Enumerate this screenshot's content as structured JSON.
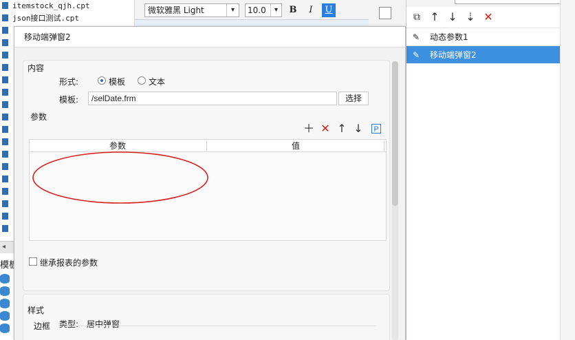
{
  "file_tree": {
    "items": [
      {
        "label": "itemstock_qjh.cpt"
      },
      {
        "label": "json接口测试.cpt"
      }
    ],
    "template_panel_label": "模板"
  },
  "toolbar": {
    "font_name": "微软雅黑 Light",
    "font_size": "10.0",
    "bold": "B",
    "italic": "I",
    "underline": "U"
  },
  "right_panel": {
    "items": [
      {
        "label": "动态参数1",
        "selected": false
      },
      {
        "label": "移动端弹窗2",
        "selected": true
      }
    ],
    "selected_color": "#3d8fe0"
  },
  "dialog": {
    "title": "移动端弹窗2",
    "content": {
      "section_title": "内容",
      "form_label": "形式:",
      "options": [
        "模板",
        "文本"
      ],
      "selected_option": "模板",
      "template_label": "模板:",
      "template_value": "/selDate.frm",
      "choose_button": "选择"
    },
    "params": {
      "section_title": "参数",
      "columns": [
        "参数",
        "值"
      ],
      "rows": [],
      "inherit_label": "继承报表的参数",
      "inherit_checked": false,
      "p_icon": "P"
    },
    "style": {
      "section_title": "样式",
      "type_label": "类型:",
      "type_value": "居中弹窗",
      "border_label": "边框"
    },
    "annotation_color": "#d61f1f"
  }
}
